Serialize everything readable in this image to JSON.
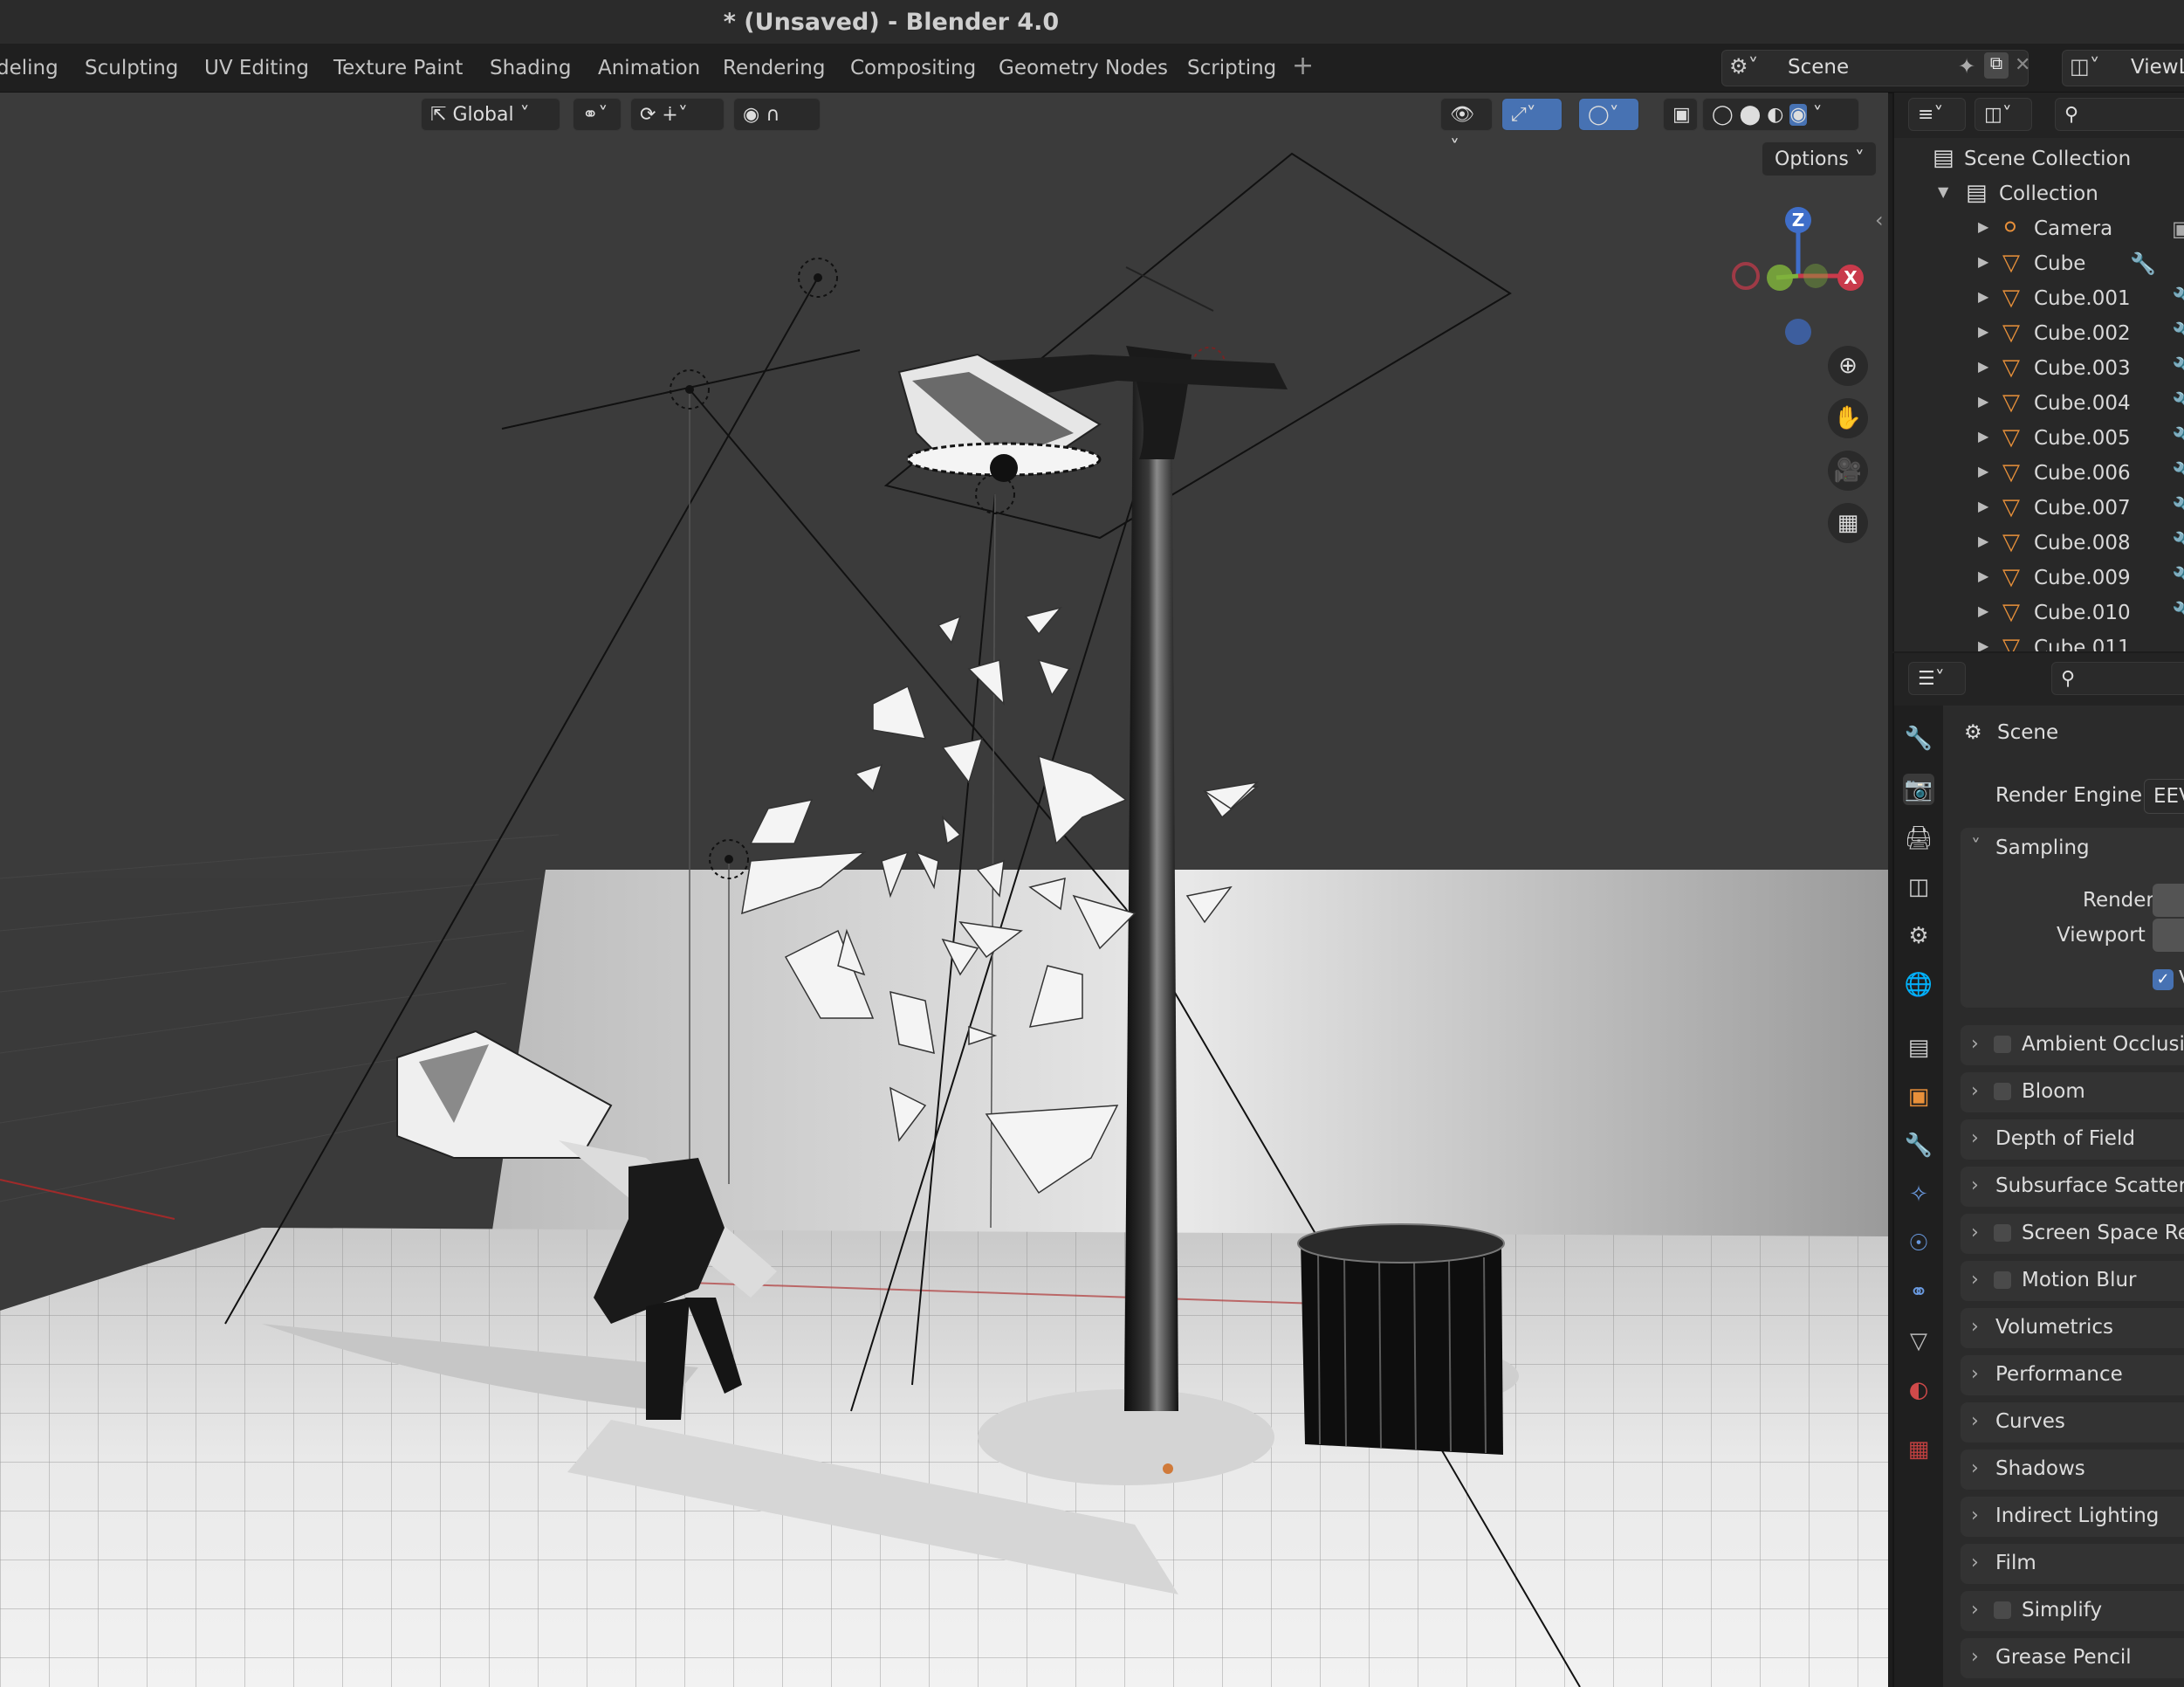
{
  "window": {
    "title": "* (Unsaved) - Blender 4.0"
  },
  "workspace_tabs": [
    "deling",
    "Sculpting",
    "UV Editing",
    "Texture Paint",
    "Shading",
    "Animation",
    "Rendering",
    "Compositing",
    "Geometry Nodes",
    "Scripting"
  ],
  "topbar": {
    "scene_name": "Scene",
    "view_layer": "ViewL"
  },
  "viewport": {
    "orientation": "Global",
    "options_label": "Options",
    "gizmo": {
      "z": "Z",
      "x": "X"
    }
  },
  "outliner": {
    "scene_collection": "Scene Collection",
    "collection": "Collection",
    "items": [
      "Camera",
      "Cube",
      "Cube.001",
      "Cube.002",
      "Cube.003",
      "Cube.004",
      "Cube.005",
      "Cube.006",
      "Cube.007",
      "Cube.008",
      "Cube.009",
      "Cube.010",
      "Cube.011"
    ]
  },
  "properties": {
    "context": "Scene",
    "render_engine_label": "Render Engine",
    "render_engine_value": "EEV",
    "sampling": {
      "title": "Sampling",
      "render": "Render",
      "viewport": "Viewport",
      "checkbox": "V"
    },
    "panels": [
      {
        "label": "Ambient Occlusion",
        "checkbox": true
      },
      {
        "label": "Bloom",
        "checkbox": true
      },
      {
        "label": "Depth of Field",
        "checkbox": false
      },
      {
        "label": "Subsurface Scattering",
        "checkbox": false
      },
      {
        "label": "Screen Space Refl",
        "checkbox": true
      },
      {
        "label": "Motion Blur",
        "checkbox": true
      },
      {
        "label": "Volumetrics",
        "checkbox": false
      },
      {
        "label": "Performance",
        "checkbox": false
      },
      {
        "label": "Curves",
        "checkbox": false
      },
      {
        "label": "Shadows",
        "checkbox": false
      },
      {
        "label": "Indirect Lighting",
        "checkbox": false
      },
      {
        "label": "Film",
        "checkbox": false
      },
      {
        "label": "Simplify",
        "checkbox": true
      },
      {
        "label": "Grease Pencil",
        "checkbox": false
      }
    ]
  },
  "colors": {
    "accent": "#4772b3",
    "mesh_icon": "#e8903a",
    "gizmo_x": "#c93a4b",
    "gizmo_y": "#7fb23c",
    "gizmo_z": "#3f6ec9"
  }
}
